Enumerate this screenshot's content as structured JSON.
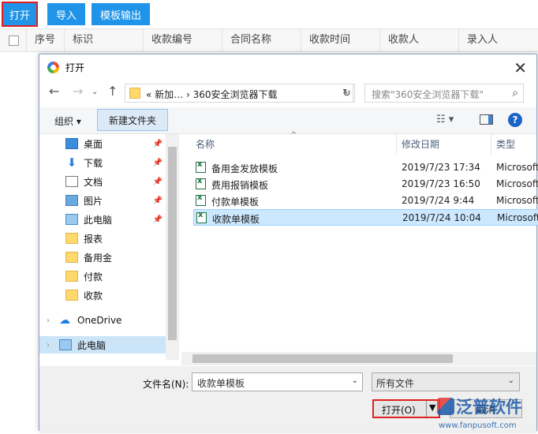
{
  "app": {
    "toolbar": {
      "open": "打开",
      "import": "导入",
      "export": "模板输出"
    },
    "table_headers": [
      "序号",
      "标识",
      "收款编号",
      "合同名称",
      "收款时间",
      "收款人",
      "录入人"
    ]
  },
  "dialog": {
    "title": "打开",
    "address": "«   新加…   ›   360安全浏览器下载",
    "search_placeholder": "搜索\"360安全浏览器下载\"",
    "organize": "组织 ▾",
    "new_folder": "新建文件夹",
    "nav": [
      {
        "label": "桌面",
        "icon": "desktop-icon",
        "pinned": true
      },
      {
        "label": "下载",
        "icon": "download-icon",
        "pinned": true
      },
      {
        "label": "文档",
        "icon": "documents-icon",
        "pinned": true
      },
      {
        "label": "图片",
        "icon": "pictures-icon",
        "pinned": true
      },
      {
        "label": "此电脑",
        "icon": "pc-icon",
        "pinned": true
      },
      {
        "label": "报表",
        "icon": "folder-icon",
        "pinned": false
      },
      {
        "label": "备用金",
        "icon": "folder-icon",
        "pinned": false
      },
      {
        "label": "付款",
        "icon": "folder-icon",
        "pinned": false
      },
      {
        "label": "收款",
        "icon": "folder-icon",
        "pinned": false
      },
      {
        "label": "OneDrive",
        "icon": "onedrive-icon",
        "pinned": false
      },
      {
        "label": "此电脑",
        "icon": "pc-icon",
        "pinned": false
      }
    ],
    "columns": {
      "name": "名称",
      "date": "修改日期",
      "type": "类型"
    },
    "files": [
      {
        "name": "备用金发放模板",
        "date": "2019/7/23 17:34",
        "type": "Microsoft"
      },
      {
        "name": "费用报销模板",
        "date": "2019/7/23 16:50",
        "type": "Microsoft"
      },
      {
        "name": "付款单模板",
        "date": "2019/7/24 9:44",
        "type": "Microsoft"
      },
      {
        "name": "收款单模板",
        "date": "2019/7/24 10:04",
        "type": "Microsoft",
        "selected": true
      }
    ],
    "filename_label": "文件名(N):",
    "filename_value": "收款单模板",
    "filetype_value": "所有文件",
    "open_button": "打开(O)",
    "cancel_button": "取消"
  },
  "watermark": {
    "brand": "泛普软件",
    "url": "www.fanpusoft.com"
  },
  "colors": {
    "accent": "#1f94e8",
    "highlight_border": "#e02020",
    "selection": "#cce8ff"
  }
}
